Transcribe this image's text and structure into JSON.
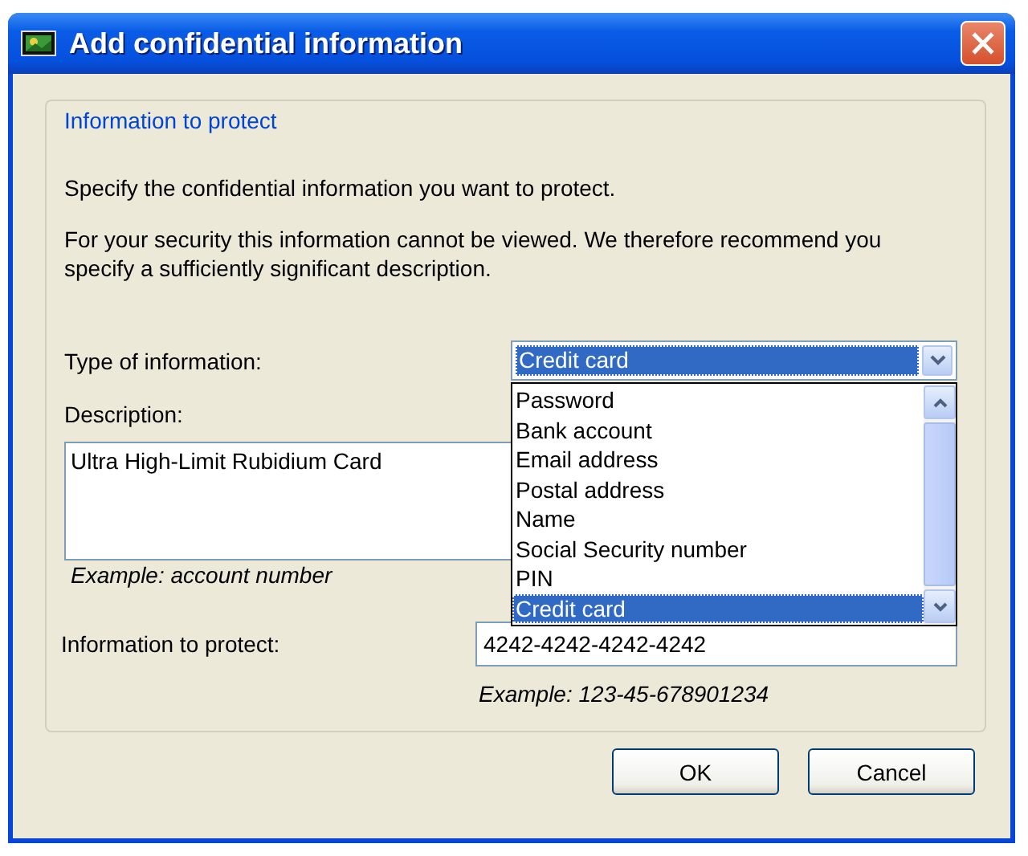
{
  "window": {
    "title": "Add confidential information"
  },
  "group": {
    "legend": "Information to protect",
    "intro": "Specify the confidential information you want to protect.",
    "note": "For your security this information cannot be viewed. We therefore recommend you specify a sufficiently significant description.",
    "type_label": "Type of information:",
    "type_combo": {
      "value": "Credit card",
      "expanded": true,
      "options": [
        {
          "label": "Password",
          "selected": false
        },
        {
          "label": "Bank account",
          "selected": false
        },
        {
          "label": "Email address",
          "selected": false
        },
        {
          "label": "Postal address",
          "selected": false
        },
        {
          "label": "Name",
          "selected": false
        },
        {
          "label": "Social Security number",
          "selected": false
        },
        {
          "label": "PIN",
          "selected": false
        },
        {
          "label": "Credit card",
          "selected": true
        }
      ]
    },
    "description_label": "Description:",
    "description_value": "Ultra High-Limit Rubidium Card",
    "description_example": "Example: account number",
    "info_label": "Information to protect:",
    "info_value": "4242-4242-4242-4242",
    "info_example": "Example: 123-45-678901234"
  },
  "buttons": [
    {
      "label": "OK"
    },
    {
      "label": "Cancel"
    }
  ]
}
